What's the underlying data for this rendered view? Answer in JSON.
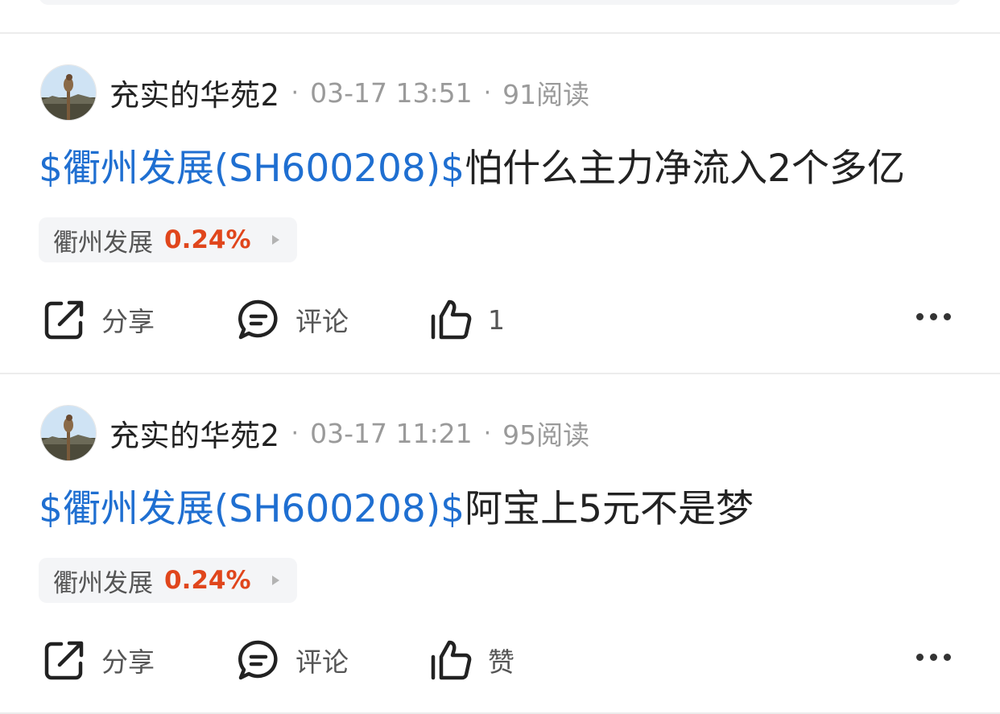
{
  "posts": [
    {
      "username": "充实的华苑2",
      "time": "03-17 13:51",
      "reads": "91阅读",
      "stock_link": "$衢州发展(SH600208)$",
      "text": "怕什么主力净流入2个多亿",
      "tag": {
        "name": "衢州发展",
        "change": "0.24%"
      },
      "share_label": "分享",
      "comment_label": "评论",
      "like_label": "1"
    },
    {
      "username": "充实的华苑2",
      "time": "03-17 11:21",
      "reads": "95阅读",
      "stock_link": "$衢州发展(SH600208)$",
      "text": "阿宝上5元不是梦",
      "tag": {
        "name": "衢州发展",
        "change": "0.24%"
      },
      "share_label": "分享",
      "comment_label": "评论",
      "like_label": "赞"
    }
  ],
  "colors": {
    "link": "#1f6fd1",
    "change_up": "#e0461c",
    "meta": "#9a9a9a"
  },
  "icons": [
    "share-icon",
    "comment-icon",
    "like-icon",
    "more-icon",
    "play-arrow-icon"
  ]
}
